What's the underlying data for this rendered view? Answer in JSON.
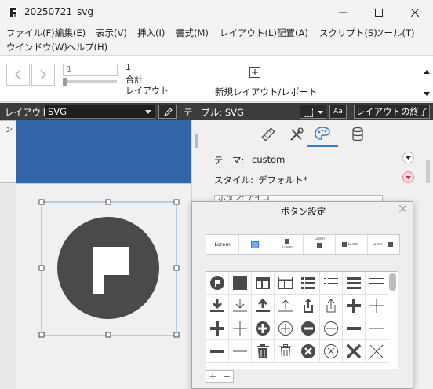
{
  "window": {
    "title": "20250721_svg"
  },
  "menu": {
    "items": [
      "ファイル(F)",
      "編集(E)",
      "表示(V)",
      "挿入(I)",
      "書式(M)",
      "レイアウト(L)",
      "配置(A)",
      "スクリプト(S)",
      "ツール(T)",
      "ウインドウ(W)",
      "ヘルプ(H)"
    ]
  },
  "toolbar": {
    "record_value": "1",
    "record_current": "1",
    "record_total_label": "合計",
    "layout_label": "レイアウト",
    "new_layout_label": "新規レイアウト/レポート"
  },
  "layoutbar": {
    "layout_label": "レイアウト:",
    "layout_value": "SVG",
    "table_label": "テーブル: SVG",
    "font_button": "Aa",
    "exit_button": "レイアウトの終了"
  },
  "side_tab": {
    "label": "上部ナビゲーション"
  },
  "inspector": {
    "theme_label": "テーマ:",
    "theme_value": "custom",
    "style_label": "スタイル:",
    "style_value": "デフォルト*",
    "partial_field": "ボタン: アイコ"
  },
  "popover": {
    "title": "ボタン設定",
    "style_presets": [
      "Lorem",
      "",
      "Lorem",
      "Lorem",
      "Lorem",
      "Lorem"
    ],
    "icons": [
      "flag-circle-icon",
      "filled-square-icon",
      "table-layout-icon",
      "table-layout-outline-icon",
      "bullet-list-icon",
      "bullet-list-outline-icon",
      "lines-icon",
      "lines-outline-icon",
      "download-icon",
      "download-outline-icon",
      "upload-icon",
      "upload-outline-icon",
      "share-icon",
      "share-outline-icon",
      "plus-bold-icon",
      "plus-thin-icon",
      "plus-bold-icon",
      "plus-thin-icon",
      "plus-circle-icon",
      "plus-circle-outline-icon",
      "minus-circle-icon",
      "minus-circle-outline-icon",
      "minus-bold-icon",
      "minus-thin-icon",
      "minus-bold-icon",
      "minus-thin-icon",
      "trash-icon",
      "trash-outline-icon",
      "x-circle-icon",
      "x-circle-outline-icon",
      "x-bold-icon",
      "x-thin-icon"
    ],
    "add_label": "+",
    "remove_label": "−"
  },
  "colors": {
    "accent_blue": "#3266a8",
    "dark_bar": "#3c3c3c",
    "icon_dark": "#4a4a4a",
    "selection": "#7aa7e0"
  }
}
